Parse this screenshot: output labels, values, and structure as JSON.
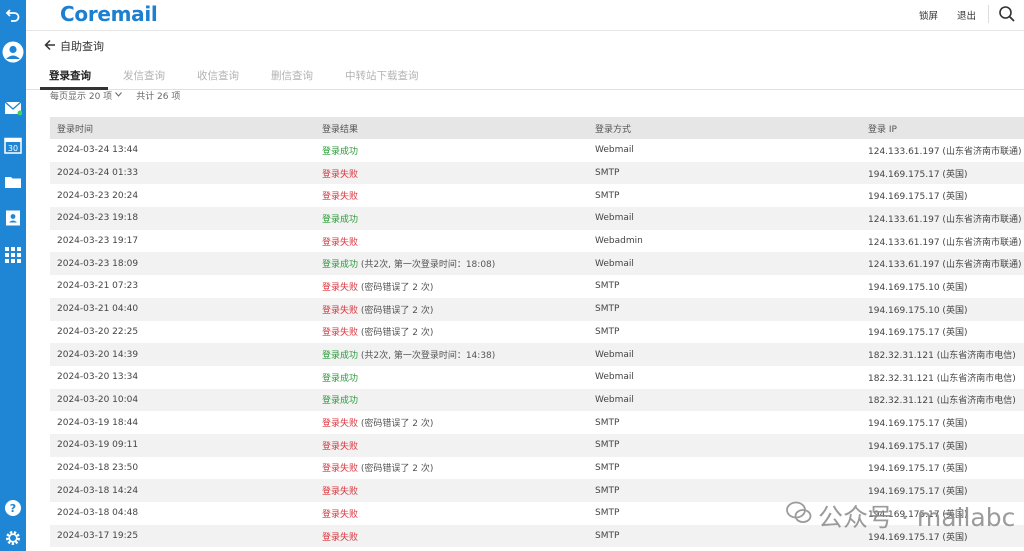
{
  "header": {
    "logo": "Coremail",
    "lock_label": "锁屏",
    "logout_label": "退出"
  },
  "back": {
    "label": "自助查询"
  },
  "tabs": [
    {
      "label": "登录查询",
      "active": true
    },
    {
      "label": "发信查询",
      "active": false
    },
    {
      "label": "收信查询",
      "active": false
    },
    {
      "label": "删信查询",
      "active": false
    },
    {
      "label": "中转站下载查询",
      "active": false
    }
  ],
  "toolbar": {
    "per_page": "每页显示 20 项",
    "total": "共计 26 项"
  },
  "table": {
    "columns": [
      "登录时间",
      "登录结果",
      "登录方式",
      "登录 IP"
    ],
    "rows": [
      {
        "time": "2024-03-24 13:44",
        "result": "登录成功",
        "status": "ok",
        "note": "",
        "method": "Webmail",
        "ip": "124.133.61.197 (山东省济南市联通)"
      },
      {
        "time": "2024-03-24 01:33",
        "result": "登录失败",
        "status": "fail",
        "note": "",
        "method": "SMTP",
        "ip": "194.169.175.17 (英国)"
      },
      {
        "time": "2024-03-23 20:24",
        "result": "登录失败",
        "status": "fail",
        "note": "",
        "method": "SMTP",
        "ip": "194.169.175.17 (英国)"
      },
      {
        "time": "2024-03-23 19:18",
        "result": "登录成功",
        "status": "ok",
        "note": "",
        "method": "Webmail",
        "ip": "124.133.61.197 (山东省济南市联通)"
      },
      {
        "time": "2024-03-23 19:17",
        "result": "登录失败",
        "status": "fail",
        "note": "",
        "method": "Webadmin",
        "ip": "124.133.61.197 (山东省济南市联通)"
      },
      {
        "time": "2024-03-23 18:09",
        "result": "登录成功",
        "status": "ok",
        "note": " (共2次, 第一次登录时间：18:08)",
        "method": "Webmail",
        "ip": "124.133.61.197 (山东省济南市联通)"
      },
      {
        "time": "2024-03-21 07:23",
        "result": "登录失败",
        "status": "fail",
        "note": " (密码错误了 2 次)",
        "method": "SMTP",
        "ip": "194.169.175.10 (英国)"
      },
      {
        "time": "2024-03-21 04:40",
        "result": "登录失败",
        "status": "fail",
        "note": " (密码错误了 2 次)",
        "method": "SMTP",
        "ip": "194.169.175.10 (英国)"
      },
      {
        "time": "2024-03-20 22:25",
        "result": "登录失败",
        "status": "fail",
        "note": " (密码错误了 2 次)",
        "method": "SMTP",
        "ip": "194.169.175.17 (英国)"
      },
      {
        "time": "2024-03-20 14:39",
        "result": "登录成功",
        "status": "ok",
        "note": " (共2次, 第一次登录时间：14:38)",
        "method": "Webmail",
        "ip": "182.32.31.121 (山东省济南市电信)"
      },
      {
        "time": "2024-03-20 13:34",
        "result": "登录成功",
        "status": "ok",
        "note": "",
        "method": "Webmail",
        "ip": "182.32.31.121 (山东省济南市电信)"
      },
      {
        "time": "2024-03-20 10:04",
        "result": "登录成功",
        "status": "ok",
        "note": "",
        "method": "Webmail",
        "ip": "182.32.31.121 (山东省济南市电信)"
      },
      {
        "time": "2024-03-19 18:44",
        "result": "登录失败",
        "status": "fail",
        "note": " (密码错误了 2 次)",
        "method": "SMTP",
        "ip": "194.169.175.17 (英国)"
      },
      {
        "time": "2024-03-19 09:11",
        "result": "登录失败",
        "status": "fail",
        "note": "",
        "method": "SMTP",
        "ip": "194.169.175.17 (英国)"
      },
      {
        "time": "2024-03-18 23:50",
        "result": "登录失败",
        "status": "fail",
        "note": " (密码错误了 2 次)",
        "method": "SMTP",
        "ip": "194.169.175.17 (英国)"
      },
      {
        "time": "2024-03-18 14:24",
        "result": "登录失败",
        "status": "fail",
        "note": "",
        "method": "SMTP",
        "ip": "194.169.175.17 (英国)"
      },
      {
        "time": "2024-03-18 04:48",
        "result": "登录失败",
        "status": "fail",
        "note": "",
        "method": "SMTP",
        "ip": "194.169.175.17 (英国)"
      },
      {
        "time": "2024-03-17 19:25",
        "result": "登录失败",
        "status": "fail",
        "note": "",
        "method": "SMTP",
        "ip": "194.169.175.17 (英国)"
      }
    ]
  },
  "watermark": {
    "text": "公众号 · mailabc"
  },
  "colors": {
    "rail": "#1f86d6",
    "logo": "#1c7fd0",
    "success": "#2b9a3a",
    "failure": "#d9363e"
  }
}
